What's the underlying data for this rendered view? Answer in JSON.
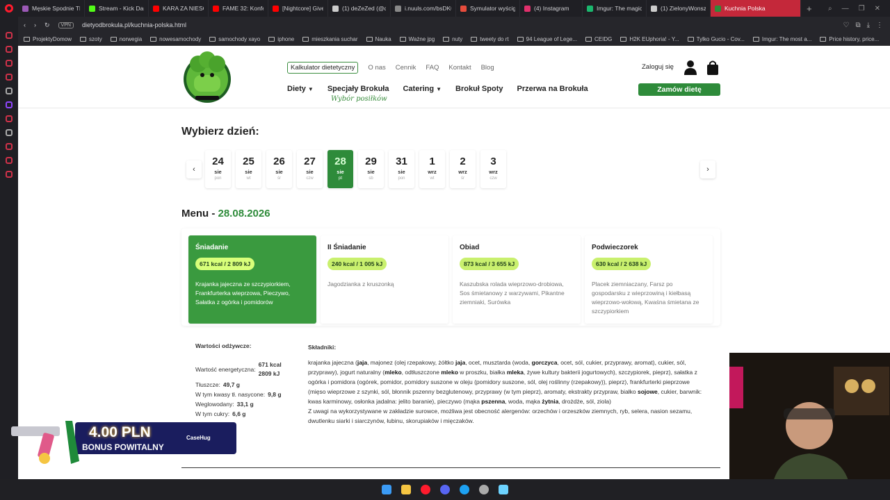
{
  "browser": {
    "tabs": [
      {
        "label": "Męskie Spodnie TH",
        "color": "#9b59b6"
      },
      {
        "label": "Stream - Kick Dash",
        "color": "#53fc18"
      },
      {
        "label": "KARA ZA NIESORT",
        "color": "#ff0000"
      },
      {
        "label": "FAME 32: Konferen",
        "color": "#ff0000"
      },
      {
        "label": "[Nightcore] Give M",
        "color": "#ff0000"
      },
      {
        "label": "(1) deZeZed (@de2",
        "color": "#cccccc"
      },
      {
        "label": "i.nuuls.com/bsDK0",
        "color": "#888888"
      },
      {
        "label": "Symulator wyścigo",
        "color": "#e74c3c"
      },
      {
        "label": "(4) Instagram",
        "color": "#e1306c"
      },
      {
        "label": "Imgur: The magic o",
        "color": "#1bb76e"
      },
      {
        "label": "(1) ZielonyWonsz w",
        "color": "#cccccc"
      },
      {
        "label": "Kuchnia Polska",
        "color": "#2e8b3a"
      }
    ],
    "vpn": "VPN",
    "url": "dietyodbrokula.pl/kuchnia-polska.html",
    "bookmarks": [
      "ProjektyDomow",
      "szoty",
      "norwegia",
      "nowesamochody",
      "samochody xayo",
      "iphone",
      "mieszkania suchar",
      "Nauka",
      "Ważne jpg",
      "nuty",
      "tweety do rt",
      "94 League of Lege...",
      "CEIDG",
      "H2K EUphoria! - Y...",
      "Tylko Gucio - Cov...",
      "Imgur: The most a...",
      "Price history, price..."
    ]
  },
  "header": {
    "nav_top": {
      "calc": "Kalkulator dietetyczny",
      "about": "O nas",
      "prices": "Cennik",
      "faq": "FAQ",
      "contact": "Kontakt",
      "blog": "Blog"
    },
    "nav_main": {
      "diets": "Diety",
      "specials": "Specjały Brokuła",
      "catering": "Catering",
      "spots": "Brokuł Spoty",
      "break": "Przerwa na Brokuła"
    },
    "nav_sub": "Wybór posiłków",
    "login": "Zaloguj się",
    "order": "Zamów dietę"
  },
  "day_picker": {
    "title": "Wybierz dzień:",
    "days": [
      {
        "num": "24",
        "mon": "sie",
        "wd": "pon"
      },
      {
        "num": "25",
        "mon": "sie",
        "wd": "wt"
      },
      {
        "num": "26",
        "mon": "sie",
        "wd": "śr"
      },
      {
        "num": "27",
        "mon": "sie",
        "wd": "czw"
      },
      {
        "num": "28",
        "mon": "sie",
        "wd": "pt"
      },
      {
        "num": "29",
        "mon": "sie",
        "wd": "sb"
      },
      {
        "num": "31",
        "mon": "sie",
        "wd": "pon"
      },
      {
        "num": "1",
        "mon": "wrz",
        "wd": "wt"
      },
      {
        "num": "2",
        "mon": "wrz",
        "wd": "śr"
      },
      {
        "num": "3",
        "mon": "wrz",
        "wd": "czw"
      }
    ],
    "selected": "28"
  },
  "menu": {
    "label": "Menu -",
    "date": "28.08.2026",
    "meals": [
      {
        "name": "Śniadanie",
        "kcal": "671 kcal / 2 809 kJ",
        "desc": "Krajanka jajeczna ze szczypiorkiem, Frankfurterka wieprzowa, Pieczywo, Sałatka z ogórka i pomidorów"
      },
      {
        "name": "II Śniadanie",
        "kcal": "240 kcal / 1 005 kJ",
        "desc": "Jagodzianka z kruszonką"
      },
      {
        "name": "Obiad",
        "kcal": "873 kcal / 3 655 kJ",
        "desc": "Kaszubska rolada wieprzowo-drobiowa, Sos śmietanowy z warzywami, Pikantne ziemniaki, Surówka"
      },
      {
        "name": "Podwieczorek",
        "kcal": "630 kcal / 2 638 kJ",
        "desc": "Placek ziemniaczany, Farsz po gospodarsku z wieprzowiną i kiełbasą wieprzowo-wołową, Kwaśna śmietana ze szczypiorkiem"
      }
    ]
  },
  "nutrition": {
    "title": "Wartości odżywcze:",
    "energy_label": "Wartość energetyczna:",
    "energy_kcal": "671 kcal",
    "energy_kj": "2809 kJ",
    "fat_label": "Tłuszcze:",
    "fat": "49,7 g",
    "sat_label": "W tym kwasy tł. nasycone:",
    "sat": "9,8 g",
    "carb_label": "Weglowodany:",
    "carb": "33,1 g",
    "sugar_label": "W tym cukry:",
    "sugar": "6,6 g"
  },
  "ingredients": {
    "title": "Składniki:",
    "allergen_note": "Z uwagi na wykorzystywane w zakładzie surowce, możliwa jest obecność alergenów: orzechów i orzeszków ziemnych, ryb, selera, nasion sezamu, dwutlenku siarki i siarczynów, łubinu, skorupiaków i mięczaków."
  },
  "promo": {
    "amount": "4.00 PLN",
    "sub": "BONUS POWITALNY",
    "brand": "CaseHug"
  }
}
